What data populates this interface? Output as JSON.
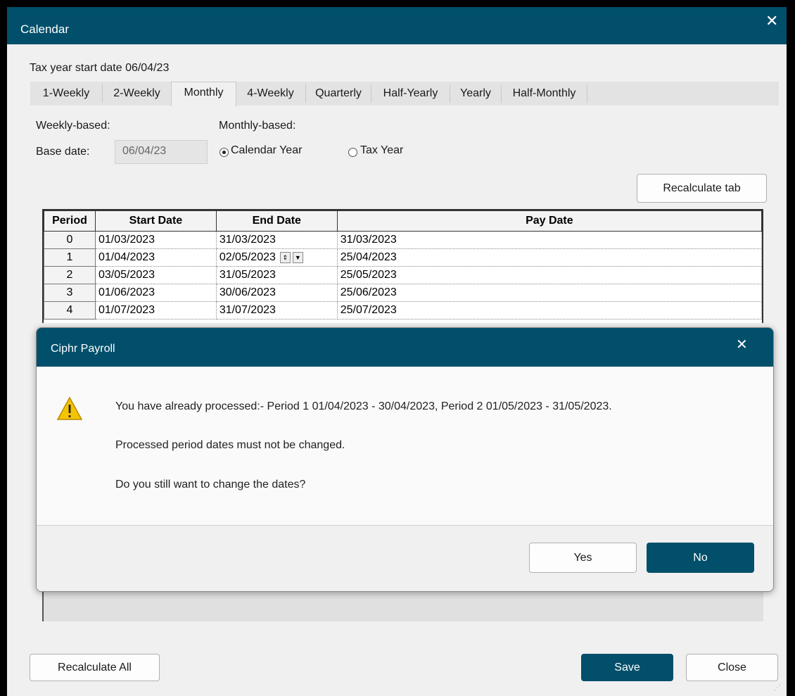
{
  "window": {
    "title": "Calendar",
    "close_glyph": "✕"
  },
  "tax_year_label": "Tax year start date 06/04/23",
  "tabs": [
    {
      "label": "1-Weekly"
    },
    {
      "label": "2-Weekly"
    },
    {
      "label": "Monthly",
      "active": true
    },
    {
      "label": "4-Weekly"
    },
    {
      "label": "Quarterly"
    },
    {
      "label": "Half-Yearly"
    },
    {
      "label": "Yearly"
    },
    {
      "label": "Half-Monthly"
    }
  ],
  "weekly": {
    "heading": "Weekly-based:",
    "base_date_label": "Base date:",
    "base_date_value": "06/04/23"
  },
  "monthly": {
    "heading": "Monthly-based:",
    "options": [
      {
        "label": "Calendar Year",
        "checked": true
      },
      {
        "label": "Tax Year",
        "checked": false
      }
    ]
  },
  "recalc_tab_label": "Recalculate tab",
  "grid": {
    "columns": [
      "Period",
      "Start Date",
      "End Date",
      "Pay Date"
    ],
    "rows": [
      {
        "period": "0",
        "start": "01/03/2023",
        "end": "31/03/2023",
        "pay": "31/03/2023"
      },
      {
        "period": "1",
        "start": "01/04/2023",
        "end": "02/05/2023",
        "pay": "25/04/2023"
      },
      {
        "period": "2",
        "start": "03/05/2023",
        "end": "31/05/2023",
        "pay": "25/05/2023"
      },
      {
        "period": "3",
        "start": "01/06/2023",
        "end": "30/06/2023",
        "pay": "25/06/2023"
      },
      {
        "period": "4",
        "start": "01/07/2023",
        "end": "31/07/2023",
        "pay": "25/07/2023"
      }
    ]
  },
  "dialog": {
    "title": "Ciphr Payroll",
    "close_glyph": "✕",
    "line1": "You have already processed:- Period 1 01/04/2023 - 30/04/2023, Period 2 01/05/2023 - 31/05/2023.",
    "line2": "Processed period dates must not be changed.",
    "line3": "Do you still want to change the dates?",
    "yes_label": "Yes",
    "no_label": "No",
    "warning_color": "#f5c400"
  },
  "footer": {
    "recalc_all_label": "Recalculate All",
    "save_label": "Save",
    "close_label": "Close"
  },
  "accent_color": "#014f6b"
}
